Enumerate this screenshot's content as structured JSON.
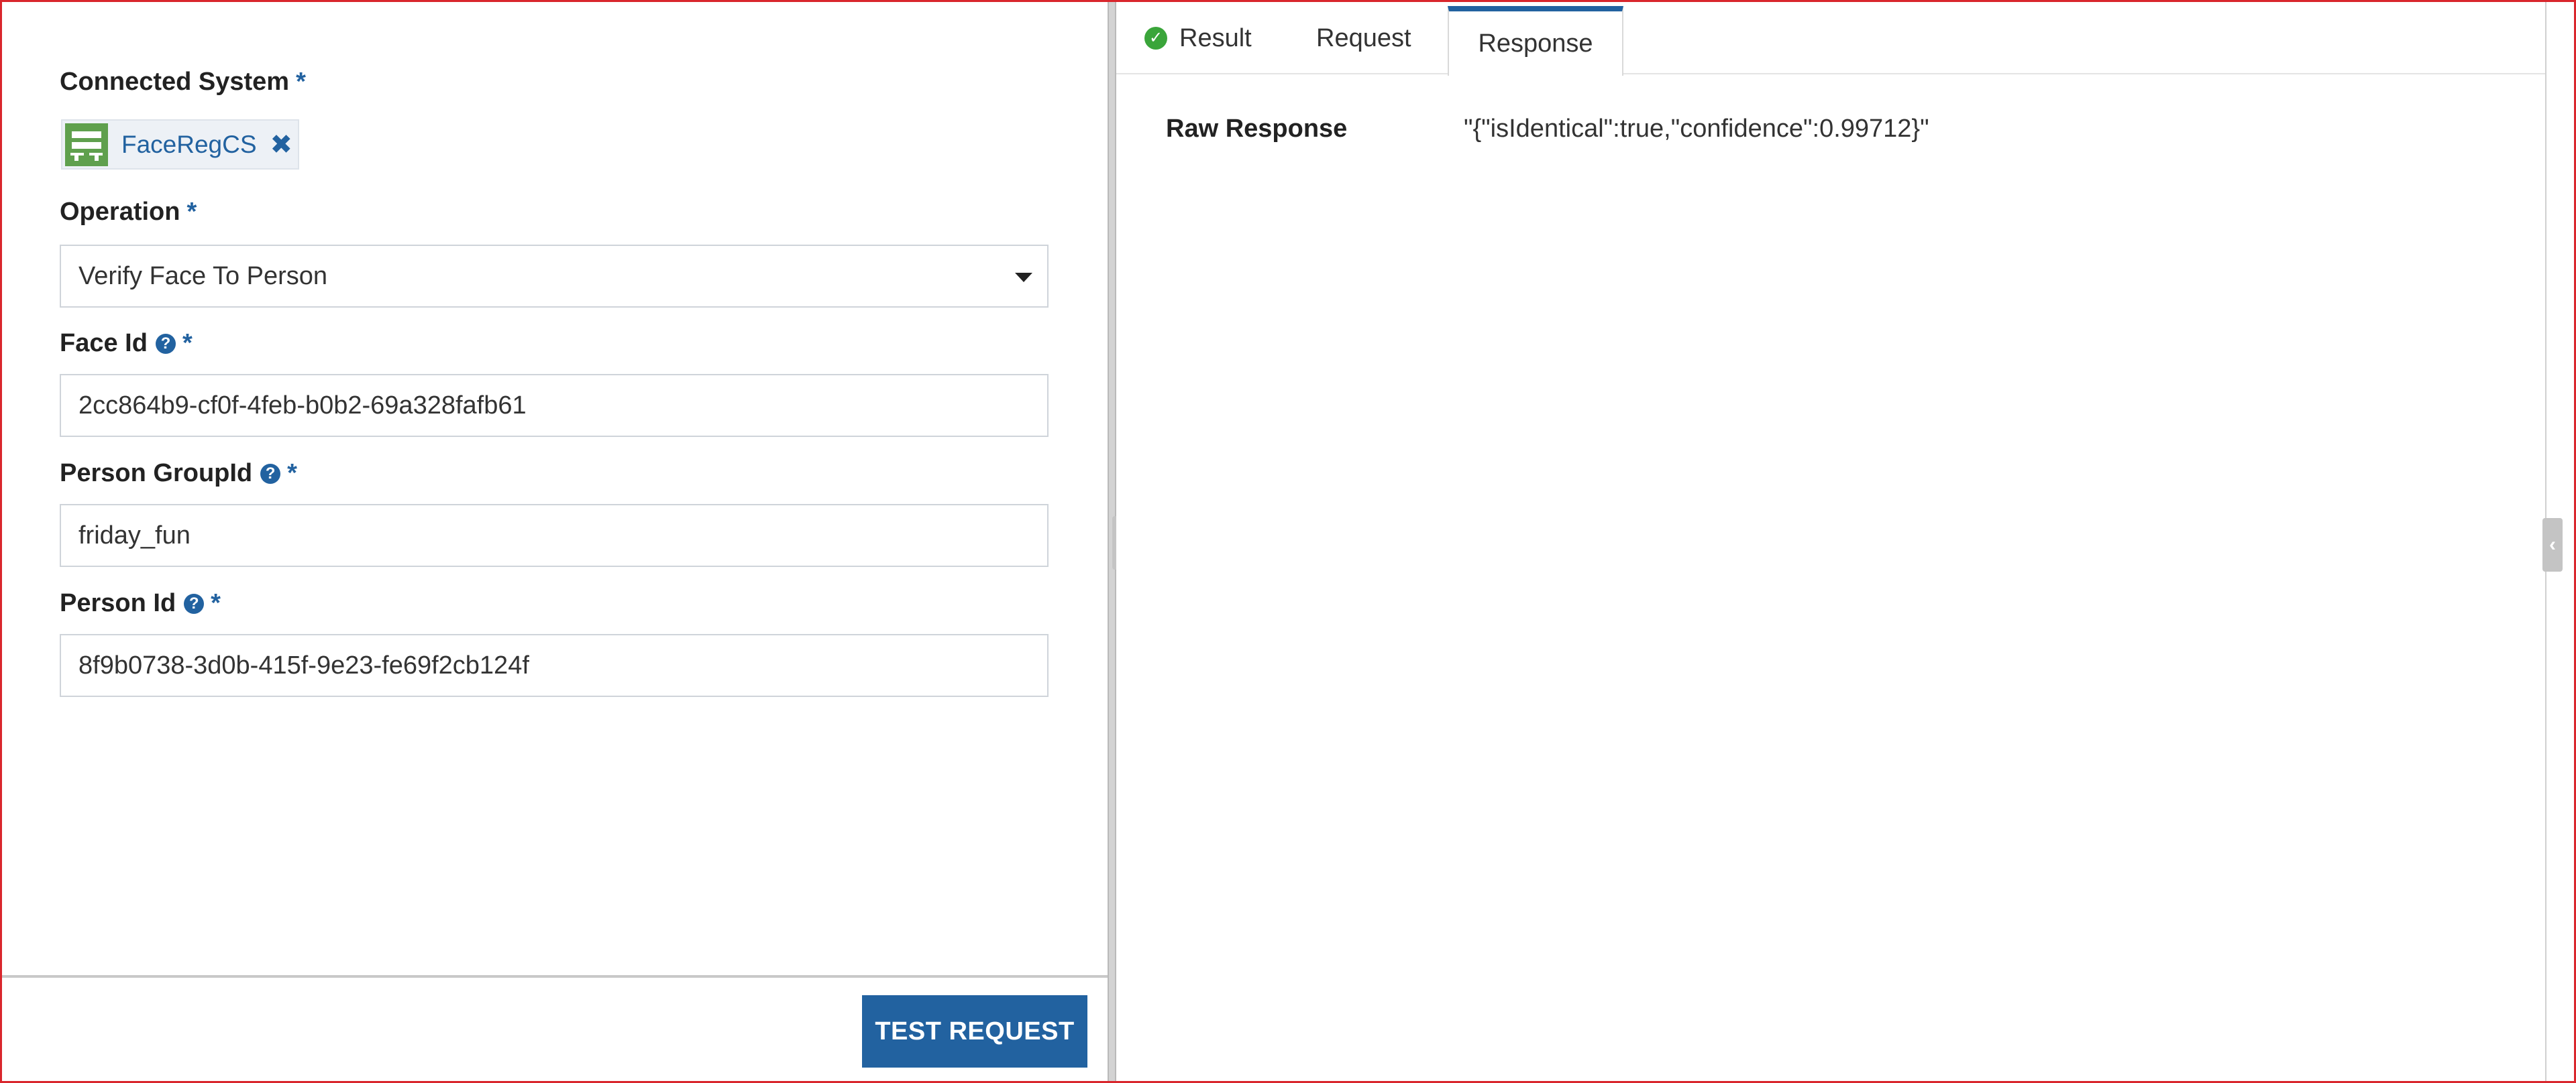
{
  "left_panel": {
    "connected_system": {
      "label": "Connected System",
      "required_mark": "*",
      "chip_label": "FaceRegCS",
      "chip_icon": "connected-system-icon",
      "remove_icon": "close-icon"
    },
    "operation": {
      "label": "Operation",
      "required_mark": "*",
      "selected_value": "Verify Face To Person"
    },
    "face_id": {
      "label": "Face Id",
      "required_mark": "*",
      "value": "2cc864b9-cf0f-4feb-b0b2-69a328fafb61"
    },
    "person_group_id": {
      "label": "Person GroupId",
      "required_mark": "*",
      "value": "friday_fun"
    },
    "person_id": {
      "label": "Person Id",
      "required_mark": "*",
      "value": "8f9b0738-3d0b-415f-9e23-fe69f2cb124f"
    },
    "test_button_label": "TEST REQUEST"
  },
  "right_panel": {
    "tabs": [
      {
        "label": "Result",
        "icon": "check-circle-icon",
        "active": false
      },
      {
        "label": "Request",
        "active": false
      },
      {
        "label": "Response",
        "active": true
      }
    ],
    "raw_response": {
      "label": "Raw Response",
      "value": "\"{\"isIdentical\":true,\"confidence\":0.99712}\""
    }
  },
  "colors": {
    "accent": "#2262a0",
    "success": "#3aa53a",
    "frame_border": "#d9262c",
    "system_icon": "#5fa04d"
  }
}
